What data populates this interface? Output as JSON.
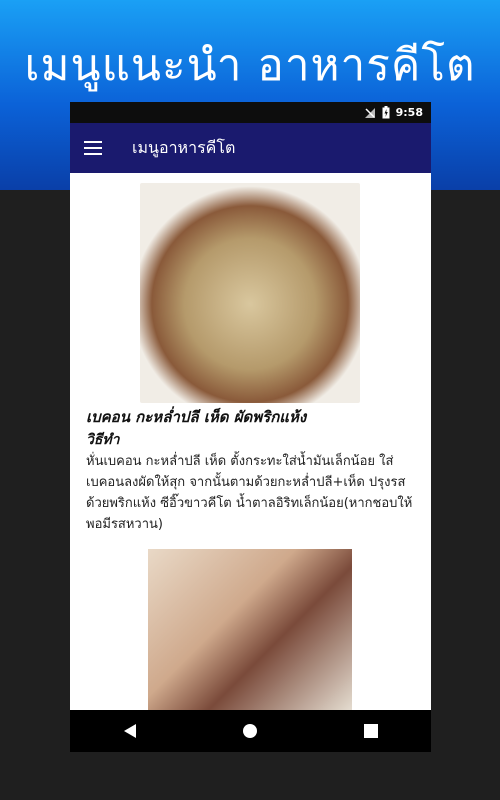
{
  "promo": {
    "title": "เมนูแนะนำ อาหารคีโต"
  },
  "status_bar": {
    "time": "9:58"
  },
  "app_bar": {
    "title": "เมนูอาหารคีโต"
  },
  "recipe": {
    "title": "เบคอน กะหล่ำปลี เห็ด ผัดพริกแห้ง",
    "method_label": "วิธีทำ",
    "body": "หั่นเบคอน กะหล่ำปลี เห็ด ตั้งกระทะใส่น้ำมันเล็กน้อย ใส่เบคอนลงผัดให้สุก จากนั้นตามด้วยกะหล่ำปลี+เห็ด ปรุงรสด้วยพริกแห้ง ซีอิ๊วขาวคีโต น้ำตาลอิริทเล็กน้อย(หากชอบให้พอมีรสหวาน)"
  },
  "colors": {
    "app_bar": "#1a1a6e",
    "promo_gradient_top": "#1aa0f5",
    "promo_gradient_bottom": "#0a3fa8"
  },
  "icons": {
    "menu": "hamburger-menu-icon",
    "signal": "no-signal-icon",
    "battery": "battery-charging-icon",
    "back": "back-triangle-icon",
    "home": "home-circle-icon",
    "recents": "recents-square-icon"
  }
}
